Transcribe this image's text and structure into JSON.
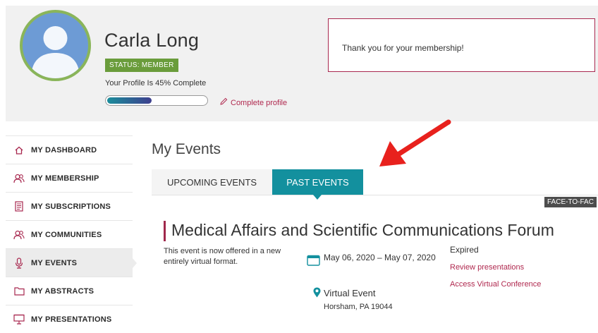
{
  "profile": {
    "name": "Carla Long",
    "status_badge": "STATUS: MEMBER",
    "progress_text": "Your Profile Is 45% Complete",
    "progress_fraction": 0.45,
    "complete_link": "Complete profile",
    "message": "Thank you for your membership!"
  },
  "sidebar": {
    "items": [
      {
        "label": "MY DASHBOARD",
        "icon": "home-icon"
      },
      {
        "label": "MY MEMBERSHIP",
        "icon": "users-icon"
      },
      {
        "label": "MY SUBSCRIPTIONS",
        "icon": "document-icon"
      },
      {
        "label": "MY COMMUNITIES",
        "icon": "users-icon"
      },
      {
        "label": "MY EVENTS",
        "icon": "microphone-icon",
        "active": true
      },
      {
        "label": "MY ABSTRACTS",
        "icon": "folder-icon"
      },
      {
        "label": "MY PRESENTATIONS",
        "icon": "presentation-icon"
      }
    ]
  },
  "main": {
    "title": "My Events",
    "tabs": [
      {
        "label": "UPCOMING EVENTS",
        "active": false
      },
      {
        "label": "PAST EVENTS",
        "active": true
      }
    ],
    "event": {
      "format_tag": "FACE-TO-FAC",
      "title": "Medical Affairs and Scientific Communications Forum",
      "description": "This event is now offered in a new entirely virtual format.",
      "dates": "May 06, 2020 – May 07, 2020",
      "venue": "Virtual Event",
      "city": "Horsham, PA 19044",
      "status": "Expired",
      "link_review": "Review presentations",
      "link_access": "Access Virtual Conference"
    }
  },
  "colors": {
    "accent": "#a8284f",
    "teal": "#13909e",
    "badge_green": "#6a9c3b",
    "annotation_arrow": "#e8211d"
  }
}
